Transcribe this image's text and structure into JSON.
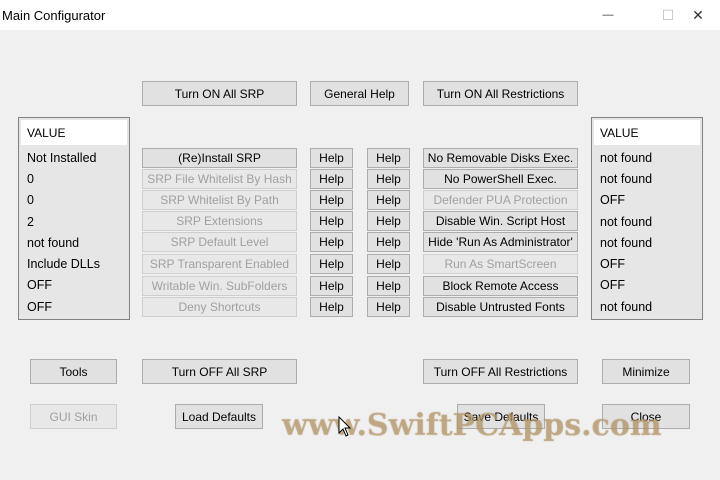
{
  "window": {
    "title": "Main Configurator",
    "min_glyph": "—",
    "max_glyph": "☐",
    "close_glyph": "✕"
  },
  "top_buttons": {
    "turn_on_srp": "Turn ON All SRP",
    "general_help": "General Help",
    "turn_on_restrictions": "Turn ON All Restrictions"
  },
  "left_list": {
    "header": "VALUE",
    "items": [
      "Not Installed",
      "0",
      "0",
      "2",
      "not found",
      "Include DLLs",
      "OFF",
      "OFF"
    ]
  },
  "right_list": {
    "header": "VALUE",
    "items": [
      "not found",
      "not found",
      "OFF",
      "not found",
      "not found",
      "OFF",
      "OFF",
      "not found"
    ]
  },
  "srp_buttons": [
    "(Re)Install SRP",
    "SRP File Whitelist By Hash",
    "SRP Whitelist By Path",
    "SRP Extensions",
    "SRP Default Level",
    "SRP Transparent Enabled",
    "Writable Win. SubFolders",
    "Deny Shortcuts"
  ],
  "help_label": "Help",
  "restriction_buttons": [
    "No Removable Disks Exec.",
    "No PowerShell Exec.",
    "Defender PUA Protection",
    "Disable Win. Script Host",
    "Hide  'Run As Administrator'",
    "Run As SmartScreen",
    "Block Remote Access",
    "Disable Untrusted Fonts"
  ],
  "bottom_buttons": {
    "tools": "Tools",
    "turn_off_srp": "Turn OFF All SRP",
    "turn_off_restrictions": "Turn OFF All Restrictions",
    "minimize": "Minimize",
    "gui_skin": "GUI Skin",
    "load_defaults": "Load Defaults",
    "save_defaults": "Save Defaults",
    "close": "Close"
  },
  "watermark": "www.SwiftPCApps.com"
}
